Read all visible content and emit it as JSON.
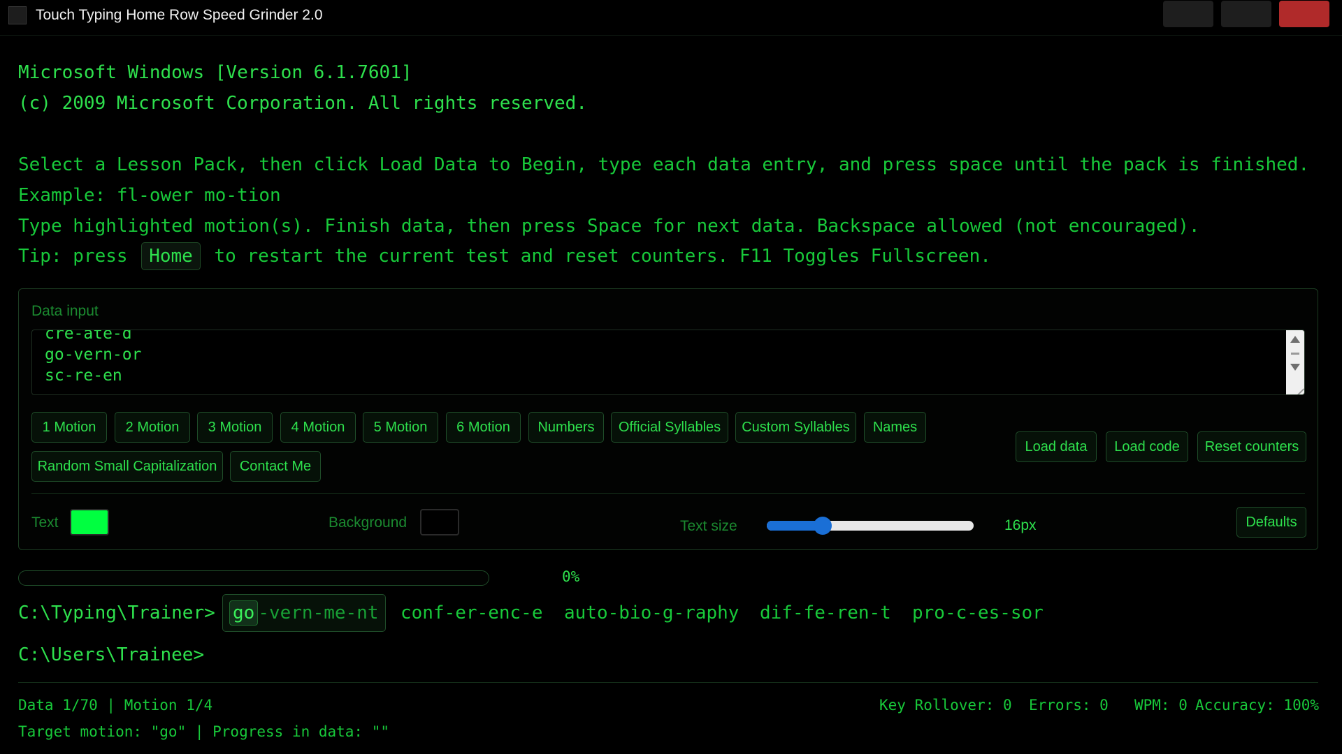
{
  "window": {
    "title": "Touch Typing Home Row Speed Grinder 2.0"
  },
  "intro": {
    "line1": "Microsoft Windows [Version 6.1.7601]",
    "line2": "(c) 2009 Microsoft Corporation. All rights reserved.",
    "line3": "Select a Lesson Pack, then click Load Data to Begin, type each data entry, and press space until the pack is finished.",
    "line4": "Example: fl-ower mo-tion",
    "line5": "Type highlighted motion(s). Finish data, then press Space for next data. Backspace allowed (not encouraged).",
    "tip_prefix": "Tip: press",
    "tip_key": "Home",
    "tip_suffix": "to restart the current test and reset counters. F11 Toggles Fullscreen."
  },
  "data_input": {
    "label": "Data input",
    "lines": [
      "cre-ate-d",
      "go-vern-or",
      "sc-re-en"
    ]
  },
  "lesson_buttons": [
    "1 Motion",
    "2 Motion",
    "3 Motion",
    "4 Motion",
    "5 Motion",
    "6 Motion",
    "Numbers",
    "Official Syllables",
    "Custom Syllables",
    "Names",
    "Random Small Capitalization",
    "Contact Me"
  ],
  "actions": {
    "load_data": "Load data",
    "load_code": "Load code",
    "reset_counters": "Reset counters",
    "defaults": "Defaults"
  },
  "settings": {
    "text_label": "Text",
    "text_color": "#00ff40",
    "background_label": "Background",
    "background_color": "#000000",
    "size_label": "Text size",
    "size_value": "16px",
    "size_level": 0.27
  },
  "progress": {
    "percent_text": "0%",
    "fraction": 0
  },
  "prompt": {
    "path": "C:\\Typing\\Trainer>",
    "current_highlight": "go",
    "current_rest": "-vern-me-nt",
    "upcoming": [
      "conf-er-enc-e",
      "auto-bio-g-raphy",
      "dif-fe-ren-t",
      "pro-c-es-sor"
    ],
    "path2": "C:\\Users\\Trainee>"
  },
  "status": {
    "data_motion": "Data 1/70 | Motion 1/4",
    "target": "Target motion: \"go\" | Progress in data: \"\"",
    "key_rollover": "Key Rollover: 0",
    "errors": "Errors: 0",
    "wpm": "WPM: 0",
    "accuracy": "Accuracy: 100%"
  }
}
